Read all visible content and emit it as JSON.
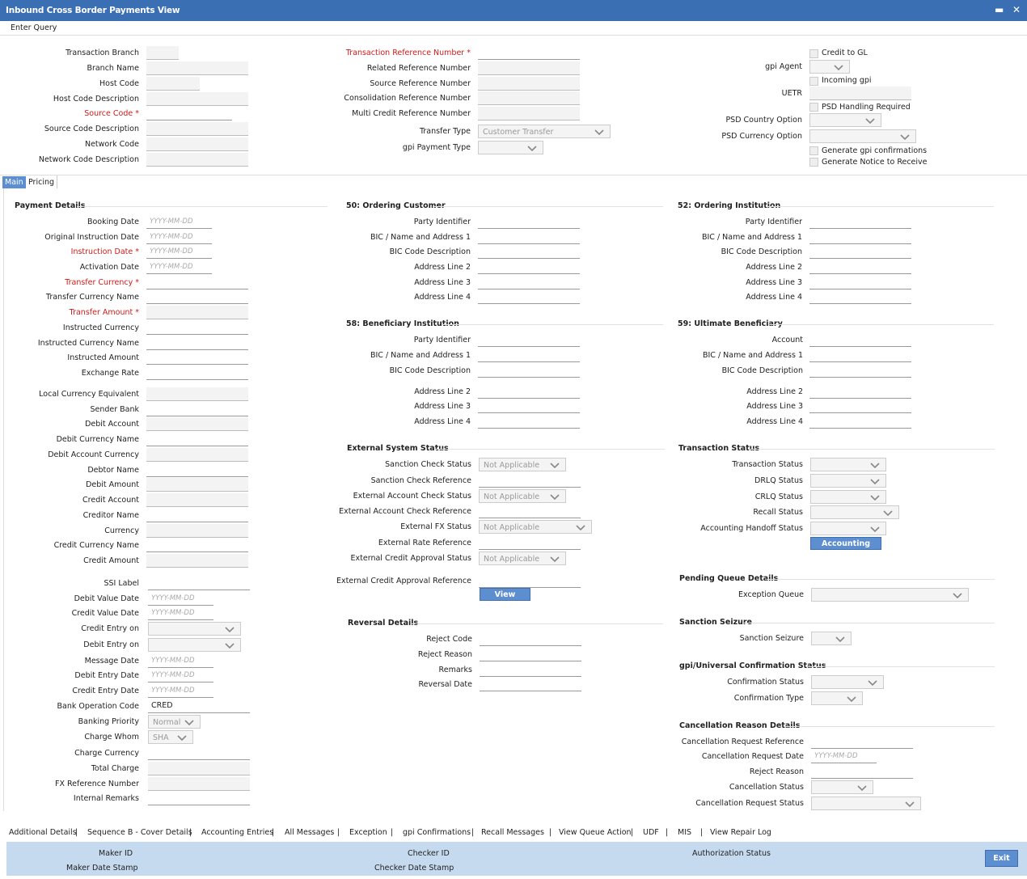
{
  "window": {
    "title": "Inbound Cross Border Payments View",
    "minimize": "▬",
    "close": "✕"
  },
  "toolbar": {
    "enter_query": "Enter Query"
  },
  "header": {
    "col1": [
      "Transaction Branch",
      "Branch Name",
      "Host Code",
      "Host Code Description",
      "Source Code",
      "Source Code Description",
      "Network Code",
      "Network Code Description"
    ],
    "col2": [
      "Transaction Reference Number",
      "Related Reference Number",
      "Source Reference Number",
      "Consolidation Reference Number",
      "Multi Credit Reference Number",
      "Transfer Type",
      "gpi Payment Type"
    ],
    "transfer_type_value": "Customer Transfer",
    "col3": {
      "credit_to_gl": "Credit to GL",
      "gpi_agent": "gpi Agent",
      "incoming_gpi": "Incoming gpi",
      "uetr": "UETR",
      "psd_handling": "PSD Handling Required",
      "psd_country": "PSD Country Option",
      "psd_currency": "PSD Currency Option",
      "gen_gpi_conf": "Generate gpi confirmations",
      "gen_notice": "Generate Notice to Receive"
    }
  },
  "tabs": [
    "Main",
    "Pricing"
  ],
  "payment_details": {
    "title": "Payment Details",
    "labels": [
      "Booking Date",
      "Original Instruction Date",
      "Instruction Date",
      "Activation Date",
      "Transfer Currency",
      "Transfer Currency Name",
      "Transfer Amount",
      "Instructed Currency",
      "Instructed Currency Name",
      "Instructed Amount",
      "Exchange Rate",
      "Local Currency Equivalent",
      "Sender Bank",
      "Debit Account",
      "Debit Currency Name",
      "Debit Account Currency",
      "Debtor Name",
      "Debit Amount",
      "Credit Account",
      "Creditor Name",
      "Currency",
      "Credit Currency Name",
      "Credit Amount",
      "SSI Label",
      "Debit Value Date",
      "Credit Value Date",
      "Credit Entry on",
      "Debit Entry on",
      "Message Date",
      "Debit Entry Date",
      "Credit Entry Date",
      "Bank Operation Code",
      "Banking Priority",
      "Charge Whom",
      "Charge Currency",
      "Total Charge",
      "FX Reference Number",
      "Internal Remarks"
    ],
    "date_placeholder": "YYYY-MM-DD",
    "bank_operation_code": "CRED",
    "banking_priority": "Normal",
    "charge_whom": "SHA"
  },
  "ordering_customer": {
    "title": "50: Ordering Customer",
    "labels": [
      "Party Identifier",
      "BIC / Name and Address 1",
      "BIC Code Description",
      "Address Line 2",
      "Address Line 3",
      "Address Line 4"
    ]
  },
  "ordering_institution": {
    "title": "52: Ordering Institution",
    "labels": [
      "Party Identifier",
      "BIC / Name and Address 1",
      "BIC Code Description",
      "Address Line 2",
      "Address Line 3",
      "Address Line 4"
    ]
  },
  "beneficiary_institution": {
    "title": "58: Beneficiary Institution",
    "labels": [
      "Party Identifier",
      "BIC / Name and Address 1",
      "BIC Code Description",
      "Address Line 2",
      "Address Line 3",
      "Address Line 4"
    ]
  },
  "ultimate_beneficiary": {
    "title": "59: Ultimate Beneficiary",
    "labels": [
      "Account",
      "BIC / Name and Address 1",
      "BIC Code Description",
      "Address Line 2",
      "Address Line 3",
      "Address Line 4"
    ]
  },
  "external_status": {
    "title": "External System Status",
    "labels": [
      "Sanction Check Status",
      "Sanction Check Reference",
      "External Account Check Status",
      "External Account Check Reference",
      "External FX Status",
      "External Rate Reference",
      "External Credit Approval Status",
      "External Credit Approval Reference"
    ],
    "na": "Not Applicable",
    "view_queue": "View Queue"
  },
  "transaction_status": {
    "title": "Transaction Status",
    "labels": [
      "Transaction Status",
      "DRLQ Status",
      "CRLQ Status",
      "Recall Status",
      "Accounting Handoff Status"
    ],
    "accounting_queue": "Accounting Queue"
  },
  "reversal": {
    "title": "Reversal Details",
    "labels": [
      "Reject Code",
      "Reject Reason",
      "Remarks",
      "Reversal Date"
    ]
  },
  "pending_queue": {
    "title": "Pending Queue Details",
    "label": "Exception Queue"
  },
  "sanction_seizure": {
    "title": "Sanction Seizure",
    "label": "Sanction Seizure"
  },
  "gpi_conf": {
    "title": "gpi/Universal Confirmation Status",
    "labels": [
      "Confirmation Status",
      "Confirmation Type"
    ]
  },
  "cancellation": {
    "title": "Cancellation Reason Details",
    "labels": [
      "Cancellation Request Reference",
      "Cancellation Request Date",
      "Reject Reason",
      "Cancellation Status",
      "Cancellation Request Status"
    ]
  },
  "bottom_links": [
    "Additional Details",
    "|",
    "Sequence B - Cover Details",
    "|",
    "Accounting Entries",
    "|",
    "All Messages",
    "|",
    "Exception",
    "|",
    "gpi Confirmations",
    "|",
    "Recall Messages",
    "|",
    "View Queue Action",
    "|",
    "UDF",
    "|",
    "MIS",
    "|",
    "View Repair Log"
  ],
  "audit": {
    "maker_id": "Maker ID",
    "maker_date": "Maker Date Stamp",
    "checker_id": "Checker ID",
    "checker_date": "Checker Date Stamp",
    "auth_status": "Authorization Status",
    "exit": "Exit"
  }
}
